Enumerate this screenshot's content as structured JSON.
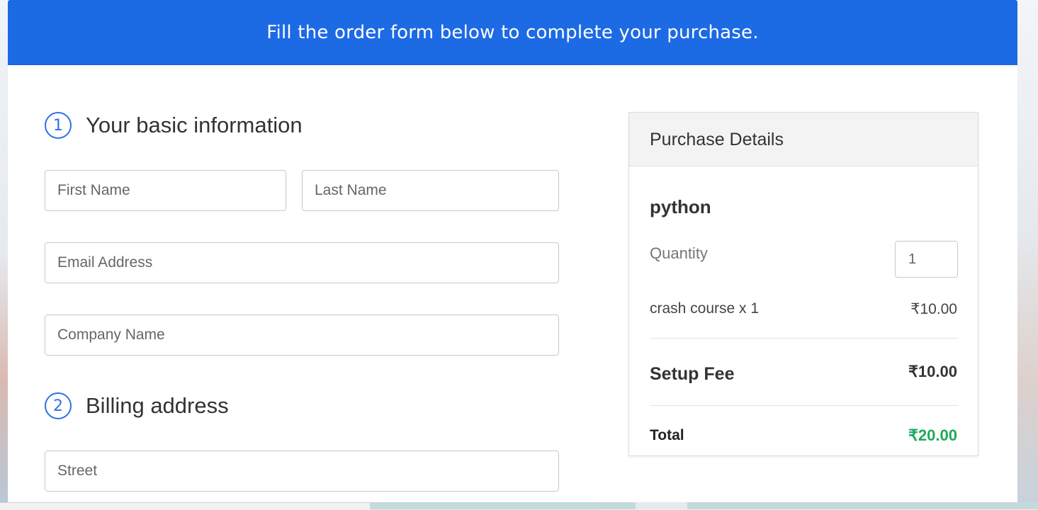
{
  "banner": {
    "text": "Fill the order form below to complete your purchase."
  },
  "form": {
    "step1": {
      "number": "1",
      "title": "Your basic information"
    },
    "step2": {
      "number": "2",
      "title": "Billing address"
    },
    "fields": {
      "first_name": {
        "placeholder": "First Name",
        "value": ""
      },
      "last_name": {
        "placeholder": "Last Name",
        "value": ""
      },
      "email": {
        "placeholder": "Email Address",
        "value": ""
      },
      "company": {
        "placeholder": "Company Name",
        "value": ""
      },
      "street": {
        "placeholder": "Street",
        "value": ""
      }
    }
  },
  "purchase": {
    "header": "Purchase Details",
    "product": "python",
    "quantity_label": "Quantity",
    "quantity_value": "1",
    "line_item": {
      "label": "crash course x 1",
      "price": "₹10.00"
    },
    "setup_fee": {
      "label": "Setup Fee",
      "price": "₹10.00"
    },
    "total": {
      "label": "Total",
      "price": "₹20.00"
    }
  },
  "colors": {
    "banner": "#1d6ae5",
    "step_accent": "#2d72e2",
    "total_price": "#1ea85a"
  }
}
